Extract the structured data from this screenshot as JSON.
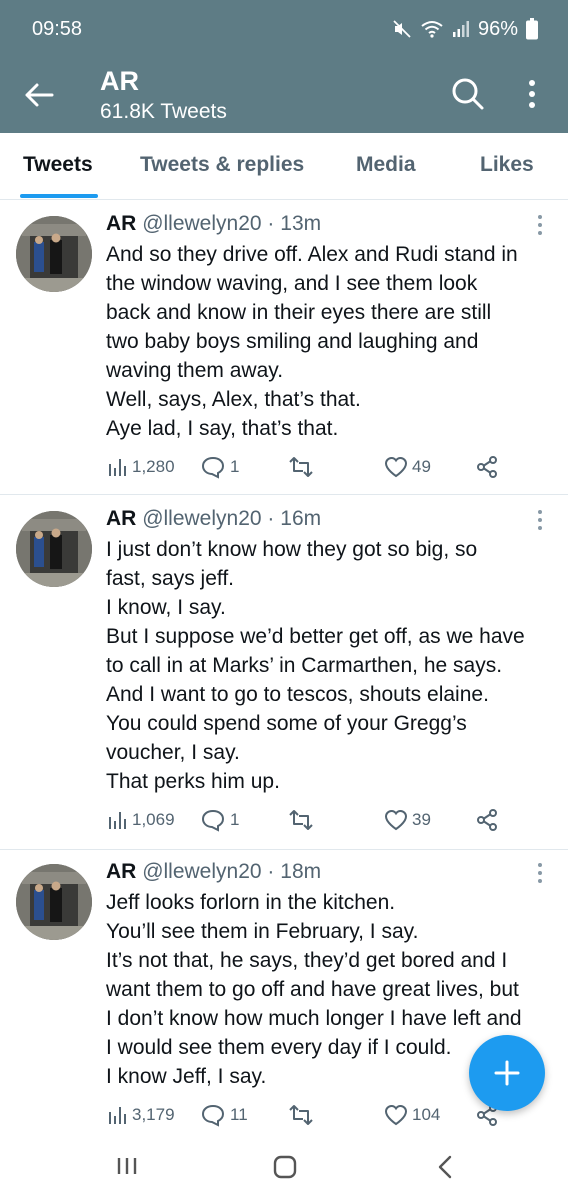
{
  "status_bar": {
    "time": "09:58",
    "battery": "96%"
  },
  "header": {
    "title": "AR",
    "subtitle": "61.8K Tweets"
  },
  "tabs": [
    {
      "label": "Tweets",
      "active": true
    },
    {
      "label": "Tweets & replies",
      "active": false
    },
    {
      "label": "Media",
      "active": false
    },
    {
      "label": "Likes",
      "active": false
    }
  ],
  "tweets": [
    {
      "name": "AR",
      "handle": "@llewelyn20",
      "time": "13m",
      "lines": [
        "And so they drive off. Alex and Rudi stand in",
        "the window waving, and I see them look",
        "back and know in their eyes there are still",
        "two baby boys smiling and laughing and",
        "waving them away.",
        "Well, says, Alex, that’s that.",
        "Aye lad, I say, that’s that."
      ],
      "views": "1,280",
      "replies": "1",
      "retweets": "",
      "likes": "49"
    },
    {
      "name": "AR",
      "handle": "@llewelyn20",
      "time": "16m",
      "lines": [
        "I just don’t know how they got so big, so",
        "fast, says jeff.",
        "I know, I say.",
        "But I suppose we’d better get off, as we have",
        "to call in at Marks’ in Carmarthen, he says.",
        "And I want to go to tescos, shouts elaine.",
        "You could spend some of your Gregg’s",
        "voucher, I say.",
        "That perks him up."
      ],
      "views": "1,069",
      "replies": "1",
      "retweets": "",
      "likes": "39"
    },
    {
      "name": "AR",
      "handle": "@llewelyn20",
      "time": "18m",
      "lines": [
        "Jeff looks forlorn in the kitchen.",
        "You’ll see them in February, I say.",
        "It’s not that, he says, they’d get bored and I",
        "want them to go off and have great lives, but",
        "I don’t know how much longer I have left and",
        "I would see them every day if I could.",
        "I know Jeff, I say."
      ],
      "views": "3,179",
      "replies": "11",
      "retweets": "",
      "likes": "104"
    }
  ],
  "colors": {
    "header_bg": "#5e7c85",
    "accent": "#1d9bf0",
    "muted": "#536471"
  }
}
